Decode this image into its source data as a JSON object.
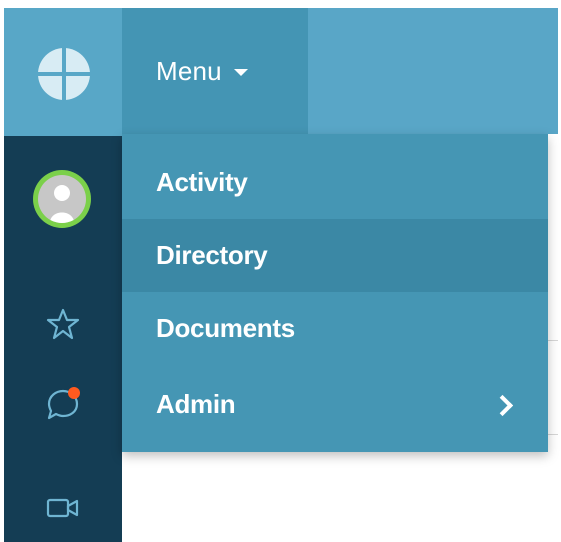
{
  "header": {
    "menu_label": "Menu"
  },
  "dropdown": {
    "items": [
      {
        "label": "Activity",
        "has_submenu": false,
        "highlighted": false
      },
      {
        "label": "Directory",
        "has_submenu": false,
        "highlighted": true
      },
      {
        "label": "Documents",
        "has_submenu": false,
        "highlighted": false
      },
      {
        "label": "Admin",
        "has_submenu": true,
        "highlighted": false
      }
    ]
  },
  "rail": {
    "icons": [
      "logo-icon",
      "avatar",
      "star-icon",
      "chat-icon",
      "video-icon"
    ],
    "notification_color": "#ff5a1f"
  },
  "colors": {
    "rail_dark": "#143d54",
    "header": "#59a6c7",
    "menu_active": "#4495b4",
    "dropdown": "#4596b4",
    "dropdown_highlight": "#3b88a5",
    "avatar_ring": "#7bd04a"
  }
}
